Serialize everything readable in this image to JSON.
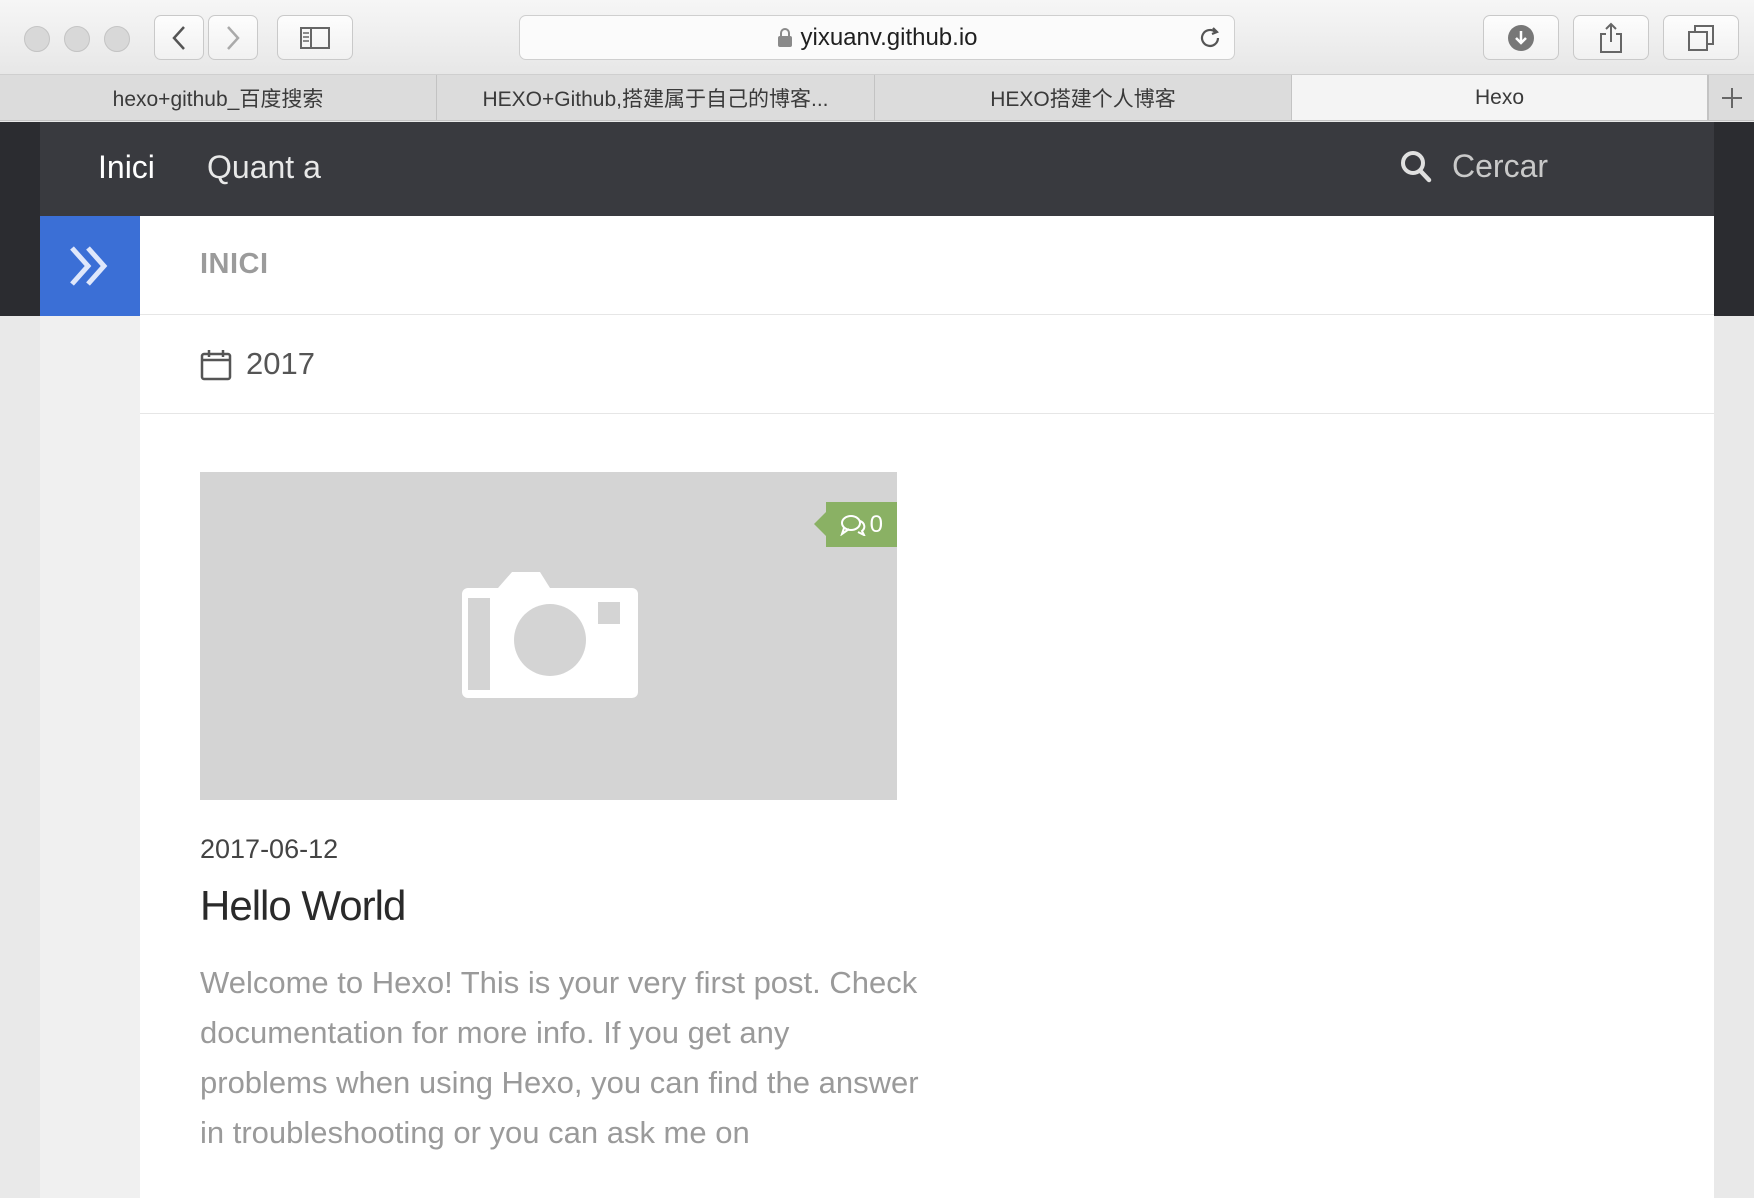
{
  "browser": {
    "url": "yixuanv.github.io",
    "tabs": [
      {
        "label": "hexo+github_百度搜索"
      },
      {
        "label": "HEXO+Github,搭建属于自己的博客..."
      },
      {
        "label": "HEXO搭建个人博客"
      },
      {
        "label": "Hexo"
      }
    ],
    "active_tab": 3
  },
  "nav": {
    "home_label": "Inici",
    "about_label": "Quant a",
    "search_label": "Cercar"
  },
  "page": {
    "title": "INICI",
    "year": "2017"
  },
  "post": {
    "comment_count": "0",
    "date": "2017-06-12",
    "title": "Hello World",
    "excerpt": "Welcome to Hexo! This is your very first post. Check documentation for more info. If you get any problems when using Hexo, you can find the answer in troubleshooting or you can ask me on"
  },
  "colors": {
    "accent_blue": "#3b6fd6",
    "comment_green": "#8ab164",
    "navbar": "#393a3f"
  }
}
